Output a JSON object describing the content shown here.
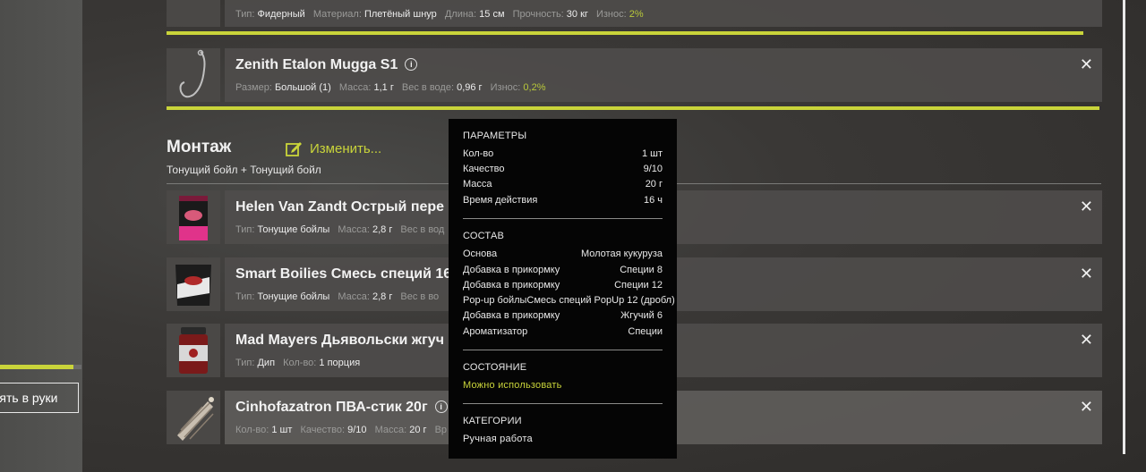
{
  "left_panel": {
    "take_button_label": "зять в руки",
    "progress_fraction": 0.9
  },
  "top_item": {
    "stats": [
      {
        "label": "Тип:",
        "value": "Фидерный"
      },
      {
        "label": "Материал:",
        "value": "Плетёный шнур"
      },
      {
        "label": "Длина:",
        "value": "15 см"
      },
      {
        "label": "Прочность:",
        "value": "30 кг"
      },
      {
        "label": "Износ:",
        "value": "2%"
      }
    ]
  },
  "hook": {
    "name": "Zenith Etalon Mugga S1",
    "info_icon": "i",
    "close": "✕",
    "stats": [
      {
        "label": "Размер:",
        "value": "Большой (1)"
      },
      {
        "label": "Масса:",
        "value": "1,1 г"
      },
      {
        "label": "Вес в воде:",
        "value": "0,96 г"
      },
      {
        "label": "Износ:",
        "value": "0,2%"
      }
    ]
  },
  "setup": {
    "title": "Монтаж",
    "edit_label": "Изменить...",
    "description": "Тонущий бойл  +  Тонущий бойл"
  },
  "baits": [
    {
      "name": "Helen Van Zandt Острый пере",
      "close": "✕",
      "stats": [
        {
          "label": "Тип:",
          "value": "Тонущие бойлы"
        },
        {
          "label": "Масса:",
          "value": "2,8 г"
        },
        {
          "label": "Вес в вод",
          "value": ""
        }
      ]
    },
    {
      "name": "Smart Boilies Смесь специй 16",
      "close": "✕",
      "stats": [
        {
          "label": "Тип:",
          "value": "Тонущие бойлы"
        },
        {
          "label": "Масса:",
          "value": "2,8 г"
        },
        {
          "label": "Вес в во",
          "value": ""
        }
      ]
    },
    {
      "name": "Mad Mayers Дьявольски жгуч",
      "close": "✕",
      "stats": [
        {
          "label": "Тип:",
          "value": "Дип"
        },
        {
          "label": "Кол-во:",
          "value": "1 порция"
        }
      ]
    },
    {
      "name": "Cinhofazatron ПВА-стик 20г",
      "close": "✕",
      "stats": [
        {
          "label": "Кол-во:",
          "value": "1 шт"
        },
        {
          "label": "Качество:",
          "value": "9/10"
        },
        {
          "label": "Масса:",
          "value": "20 г"
        },
        {
          "label": "Вр",
          "value": ""
        }
      ]
    }
  ],
  "tooltip": {
    "params_title": "ПАРАМЕТРЫ",
    "params": [
      {
        "label": "Кол-во",
        "value": "1 шт"
      },
      {
        "label": "Качество",
        "value": "9/10"
      },
      {
        "label": "Масса",
        "value": "20 г"
      },
      {
        "label": "Время действия",
        "value": "16 ч"
      }
    ],
    "composition_title": "СОСТАВ",
    "composition": [
      {
        "label": "Основа",
        "value": "Молотая кукуруза"
      },
      {
        "label": "Добавка в прикормку",
        "value": "Специи 8"
      },
      {
        "label": "Добавка в прикормку",
        "value": "Специи 12"
      },
      {
        "label": "Pop-up бойлы",
        "value": "Смесь специй PopUp 12 (дробл)"
      },
      {
        "label": "Добавка в прикормку",
        "value": "Жгучий 6"
      },
      {
        "label": "Ароматизатор",
        "value": "Специи"
      }
    ],
    "state_title": "СОСТОЯНИЕ",
    "state_value": "Можно использовать",
    "categories_title": "КАТЕГОРИИ",
    "categories_value": "Ручная работа"
  },
  "colors": {
    "accent": "#c9d43a",
    "tooltip_bg": "#050505",
    "row_bg": "#504e4c"
  }
}
